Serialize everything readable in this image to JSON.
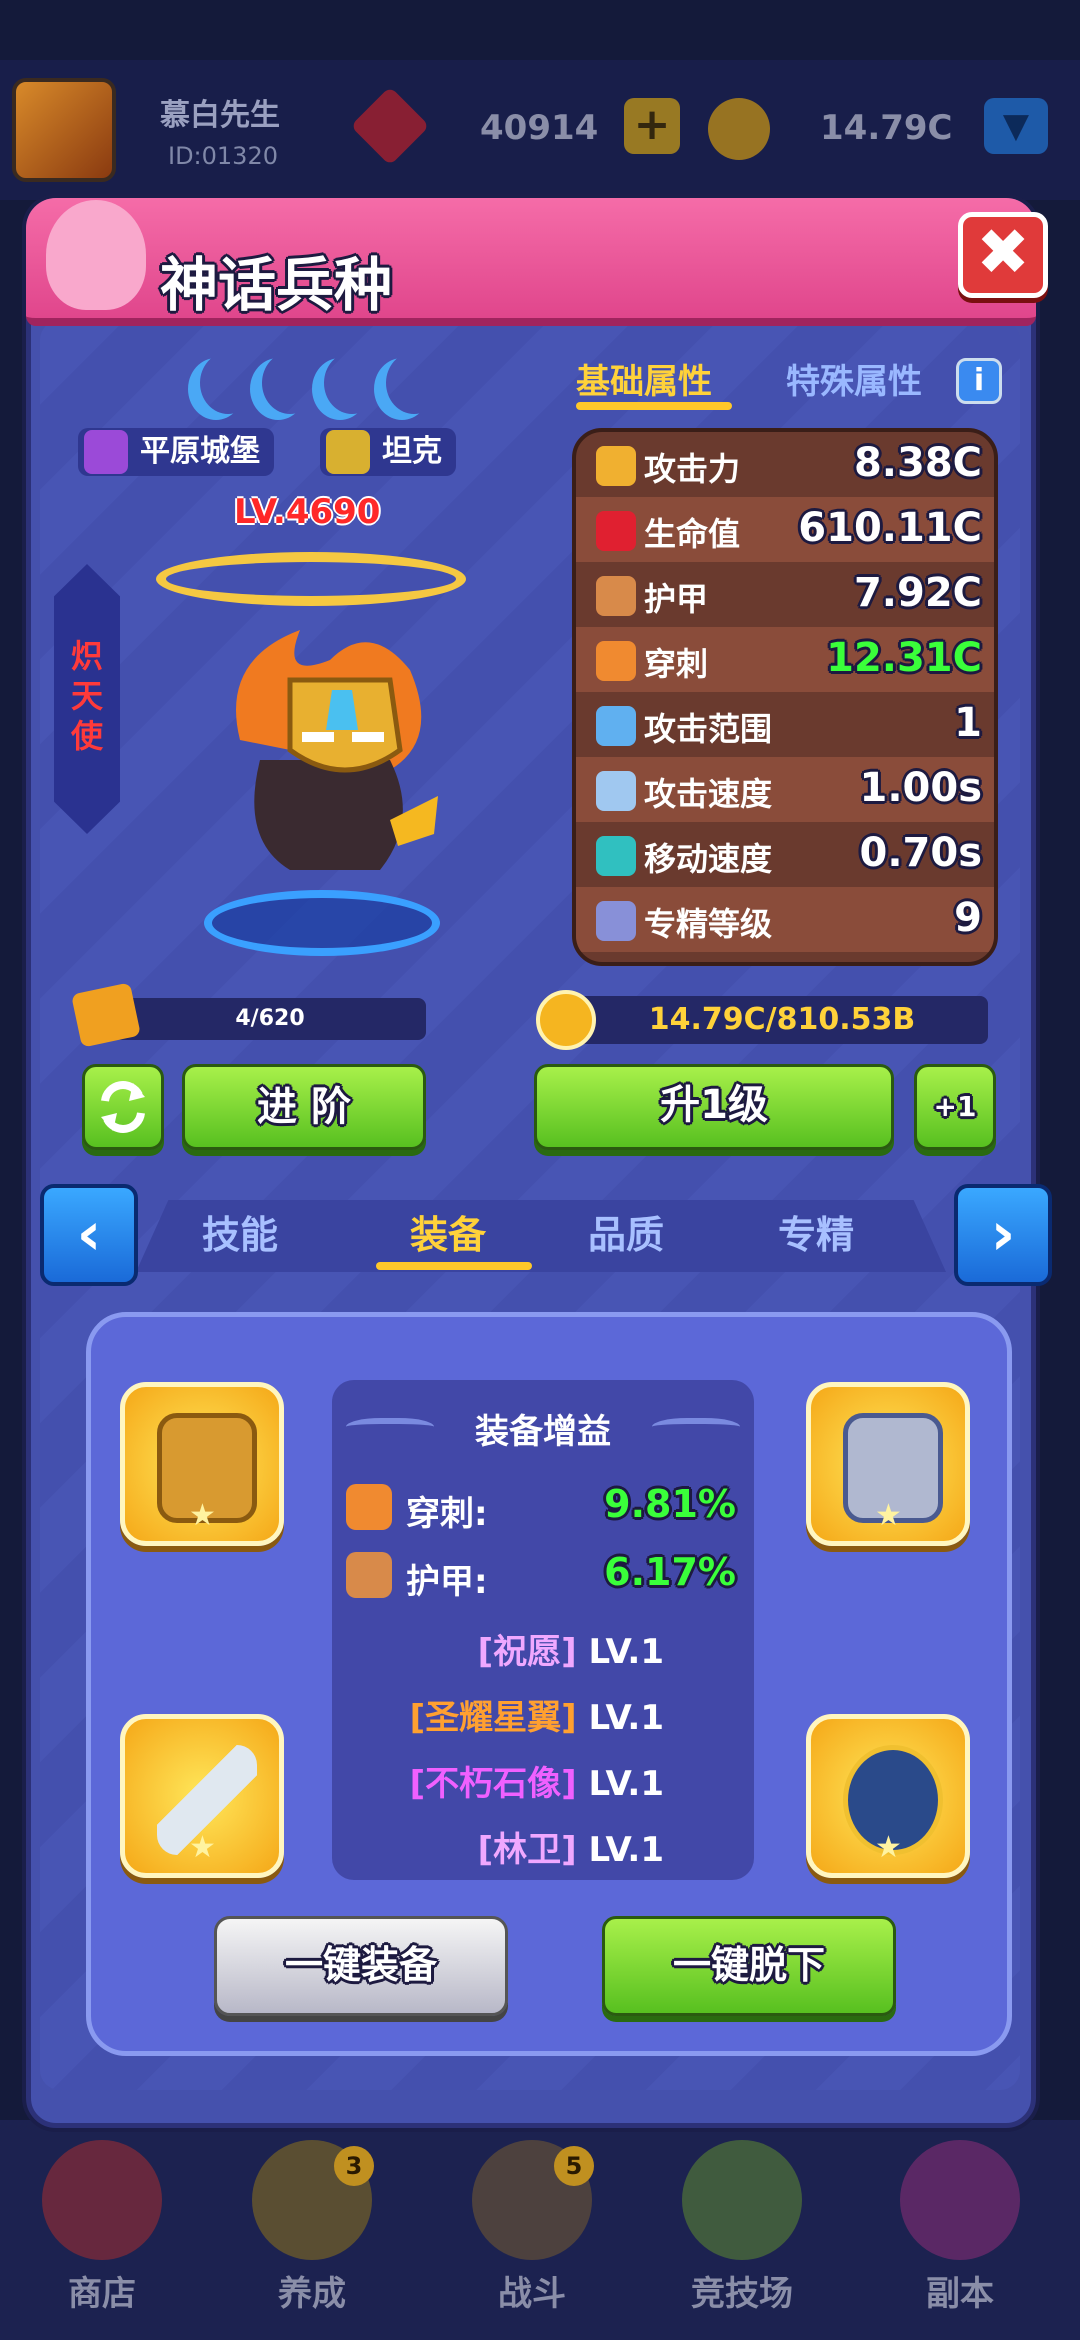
{
  "top_bar": {
    "player_name": "慕白先生",
    "player_id": "ID:01320",
    "gems": "40914",
    "gem_add_label": "+",
    "coins": "14.79C",
    "dropdown_label": "▼"
  },
  "panel": {
    "title": "神话兵种",
    "close_label": "✖"
  },
  "hero": {
    "name": "炽天使",
    "level": "LV.4690",
    "moon_count": 4,
    "tags": [
      {
        "label": "平原城堡",
        "icon": "castle-emblem-icon",
        "color": "#9b4ad8"
      },
      {
        "label": "坦克",
        "icon": "shield-icon",
        "color": "#d8b030"
      }
    ]
  },
  "attr_tabs": {
    "basic": "基础属性",
    "special": "特殊属性",
    "info": "i"
  },
  "stats": [
    {
      "label": "攻击力",
      "value": "8.38C",
      "icon": "sword-icon",
      "icon_color": "#f0b030",
      "value_color": "#ffffff"
    },
    {
      "label": "生命值",
      "value": "610.11C",
      "icon": "heart-icon",
      "icon_color": "#e02030",
      "value_color": "#ffffff"
    },
    {
      "label": "护甲",
      "value": "7.92C",
      "icon": "armor-icon",
      "icon_color": "#d88a4a",
      "value_color": "#ffffff"
    },
    {
      "label": "穿刺",
      "value": "12.31C",
      "icon": "pierce-icon",
      "icon_color": "#f08a30",
      "value_color": "#3aff3a"
    },
    {
      "label": "攻击范围",
      "value": "1",
      "icon": "range-icon",
      "icon_color": "#60b0f0",
      "value_color": "#ffffff"
    },
    {
      "label": "攻击速度",
      "value": "1.00s",
      "icon": "attack-speed-icon",
      "icon_color": "#a0c8f0",
      "value_color": "#ffffff"
    },
    {
      "label": "移动速度",
      "value": "0.70s",
      "icon": "boot-icon",
      "icon_color": "#30c0c0",
      "value_color": "#ffffff"
    },
    {
      "label": "专精等级",
      "value": "9",
      "icon": "mastery-icon",
      "icon_color": "#8890d8",
      "value_color": "#ffffff"
    }
  ],
  "progress": {
    "shards": "4/620",
    "coins": "14.79C/810.53B"
  },
  "buttons": {
    "swap": "⟳",
    "advance": "进 阶",
    "level_up": "升1级",
    "plus_one": "+1",
    "prev": "‹",
    "next": "›"
  },
  "sub_tabs": {
    "skills": "技能",
    "equipment": "装备",
    "quality": "品质",
    "mastery": "专精"
  },
  "equipment": {
    "bonus_title": "装备增益",
    "bonuses": [
      {
        "label": "穿刺:",
        "value": "9.81%",
        "icon": "pierce-icon"
      },
      {
        "label": "护甲:",
        "value": "6.17%",
        "icon": "armor-icon"
      }
    ],
    "sets": [
      {
        "name": "祝愿",
        "level": "LV.1",
        "color": "#f0a8ff"
      },
      {
        "name": "圣耀星翼",
        "level": "LV.1",
        "color": "#ffa030"
      },
      {
        "name": "不朽石像",
        "level": "LV.1",
        "color": "#f060ff"
      },
      {
        "name": "林卫",
        "level": "LV.1",
        "color": "#f0a8ff"
      }
    ],
    "slots": [
      {
        "name": "helmet",
        "icon": "helmet-icon"
      },
      {
        "name": "chest-armor",
        "icon": "chest-armor-icon"
      },
      {
        "name": "sword",
        "icon": "sword-icon"
      },
      {
        "name": "amulet",
        "icon": "amulet-icon"
      }
    ],
    "equip_all": "一键装备",
    "unequip_all": "一键脱下"
  },
  "bottom_nav": [
    {
      "label": "商店",
      "badge": ""
    },
    {
      "label": "养成",
      "badge": "3"
    },
    {
      "label": "战斗",
      "badge": "5"
    },
    {
      "label": "竞技场",
      "badge": ""
    },
    {
      "label": "副本",
      "badge": ""
    }
  ]
}
